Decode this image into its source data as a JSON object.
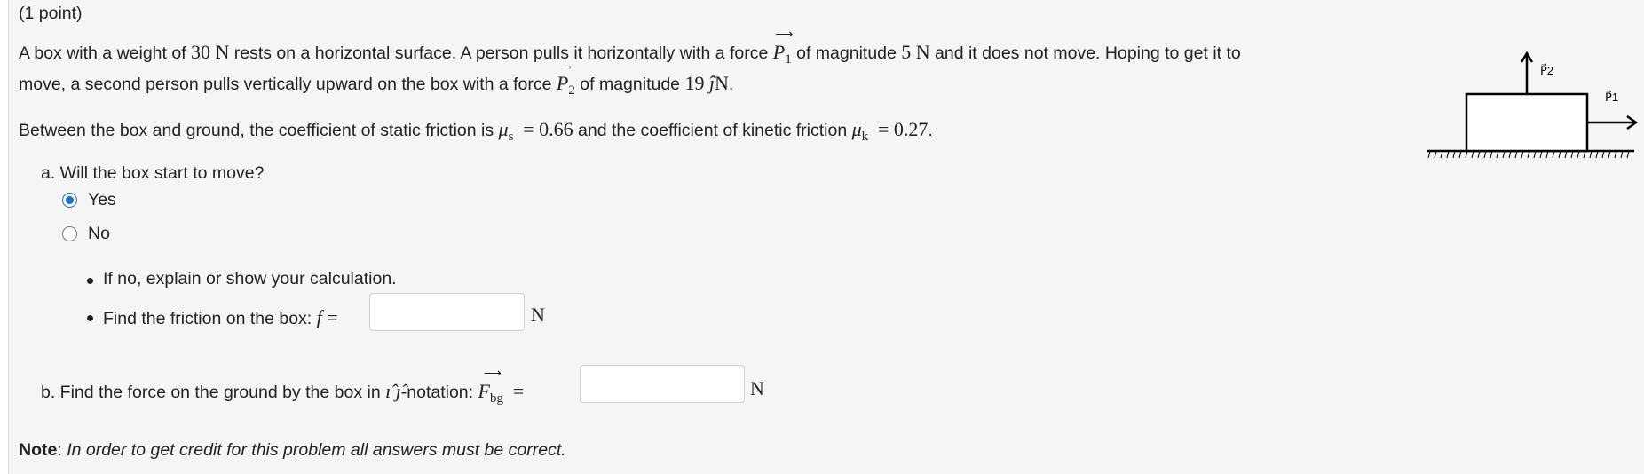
{
  "problem": {
    "points": "(1 point)",
    "intro": {
      "t1": "A box with a weight of ",
      "weight": "30",
      "unit_n": "N",
      "t2": " rests on a horizontal surface. A person pulls it horizontally with a force ",
      "p_sym": "P",
      "p1_sub": "1",
      "t3": " of magnitude ",
      "p1_mag": "5",
      "t4": " and it does not move. Hoping to get it to",
      "t5": "move, a second person pulls vertically upward on the box with a force ",
      "p2_sub": "2",
      "t6": " of magnitude ",
      "p2_mag": "19",
      "jhat": "ĵ",
      "period": "."
    },
    "friction": {
      "t1": "Between the box and ground, the coefficient of static friction is ",
      "mu": "μ",
      "s_sub": "s",
      "eq": "=",
      "mu_s": "0.66",
      "t2": " and the coefficient of kinetic friction ",
      "k_sub": "k",
      "mu_k": "0.27",
      "period": "."
    },
    "part_a": {
      "question": "a. Will the box start to move?",
      "options": [
        "Yes",
        "No"
      ],
      "selected": "Yes",
      "bullet1": "If no, explain or show your calculation.",
      "bullet2": "Find the friction on the box: ",
      "f_sym": "f",
      "eq": "=",
      "unit": "N",
      "answer_value": ""
    },
    "part_b": {
      "t1": "b. Find the force on the ground by the box in ",
      "ihat": "ı̂",
      "jhat": "ȷ̂",
      "t2": "-notation: ",
      "f_sym": "F",
      "f_sub": "bg",
      "eq": "=",
      "unit": "N",
      "answer_value": ""
    },
    "note": {
      "label": "Note",
      "colon": ": ",
      "text": "In order to get credit for this problem all answers must be correct."
    },
    "figure": {
      "label_p1": "P⃗1",
      "label_p2": "P⃗2"
    }
  }
}
